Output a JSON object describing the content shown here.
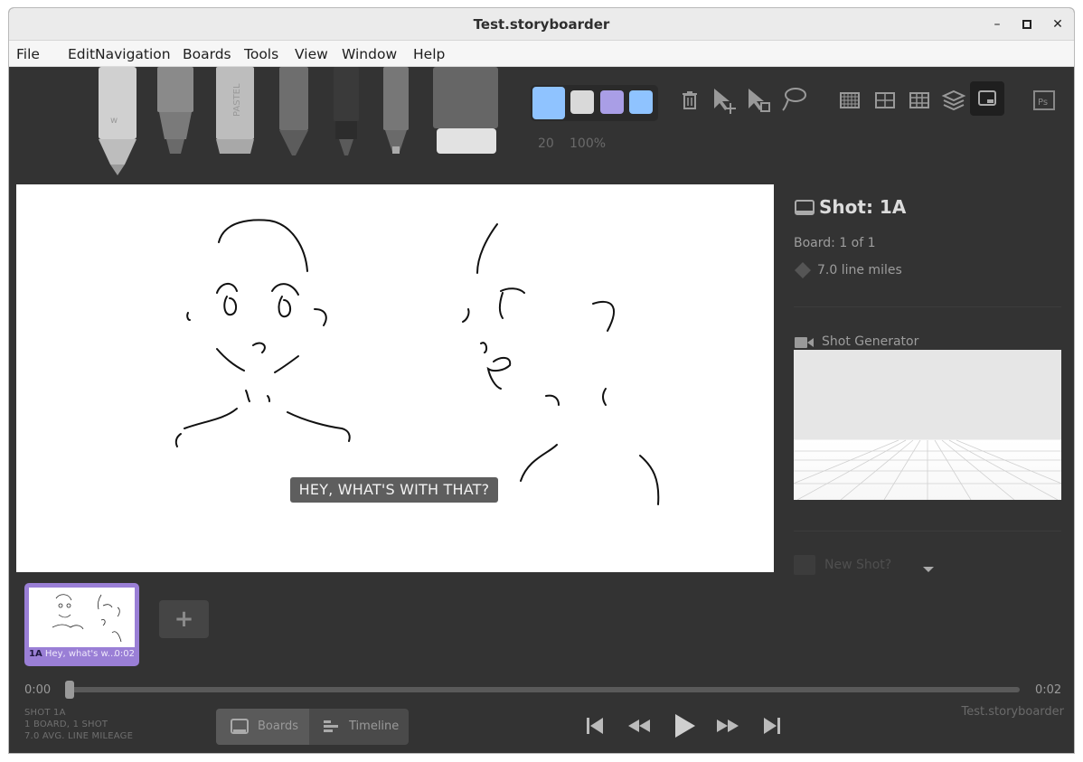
{
  "window": {
    "title": "Test.storyboarder",
    "minimize_icon": "minimize-icon",
    "maximize_icon": "maximize-icon",
    "close_icon": "close-icon"
  },
  "menu": [
    "File",
    "Edit",
    "Navigation",
    "Boards",
    "Tools",
    "View",
    "Window",
    "Help"
  ],
  "toolbar": {
    "brush_size": "20",
    "opacity": "100%",
    "colors": [
      "#8fc3ff",
      "#d9d9d9",
      "#a99ee6",
      "#8fc3ff"
    ],
    "icons": [
      "light-pencil-icon",
      "brush-icon",
      "pastel-icon",
      "pencil-icon",
      "pen-icon",
      "fine-pen-icon",
      "eraser-icon",
      "trash-icon",
      "move-icon",
      "scale-icon",
      "lasso-icon",
      "grid-icon",
      "center-guide-icon",
      "thirds-guide-icon",
      "layers-icon",
      "caption-toggle-icon",
      "photoshop-icon"
    ]
  },
  "canvas": {
    "caption": "HEY, WHAT'S WITH THAT?"
  },
  "side": {
    "shot_title": "Shot: 1A",
    "board_count": "Board: 1 of 1",
    "line_miles": "7.0 line miles",
    "shot_generator_label": "Shot Generator",
    "new_shot_label": "New Shot?"
  },
  "thumbnail": {
    "shot": "1A",
    "dialogue": "Hey, what's w...",
    "duration": "0:02"
  },
  "add_board_label": "+",
  "timeline": {
    "start": "0:00",
    "end": "0:02",
    "position": 0.0,
    "stats": [
      "SHOT 1A",
      "1 BOARD, 1 SHOT",
      "7.0 AVG. LINE MILEAGE"
    ],
    "project_name": "Test.storyboarder",
    "boards_label": "Boards",
    "timeline_label": "Timeline"
  }
}
